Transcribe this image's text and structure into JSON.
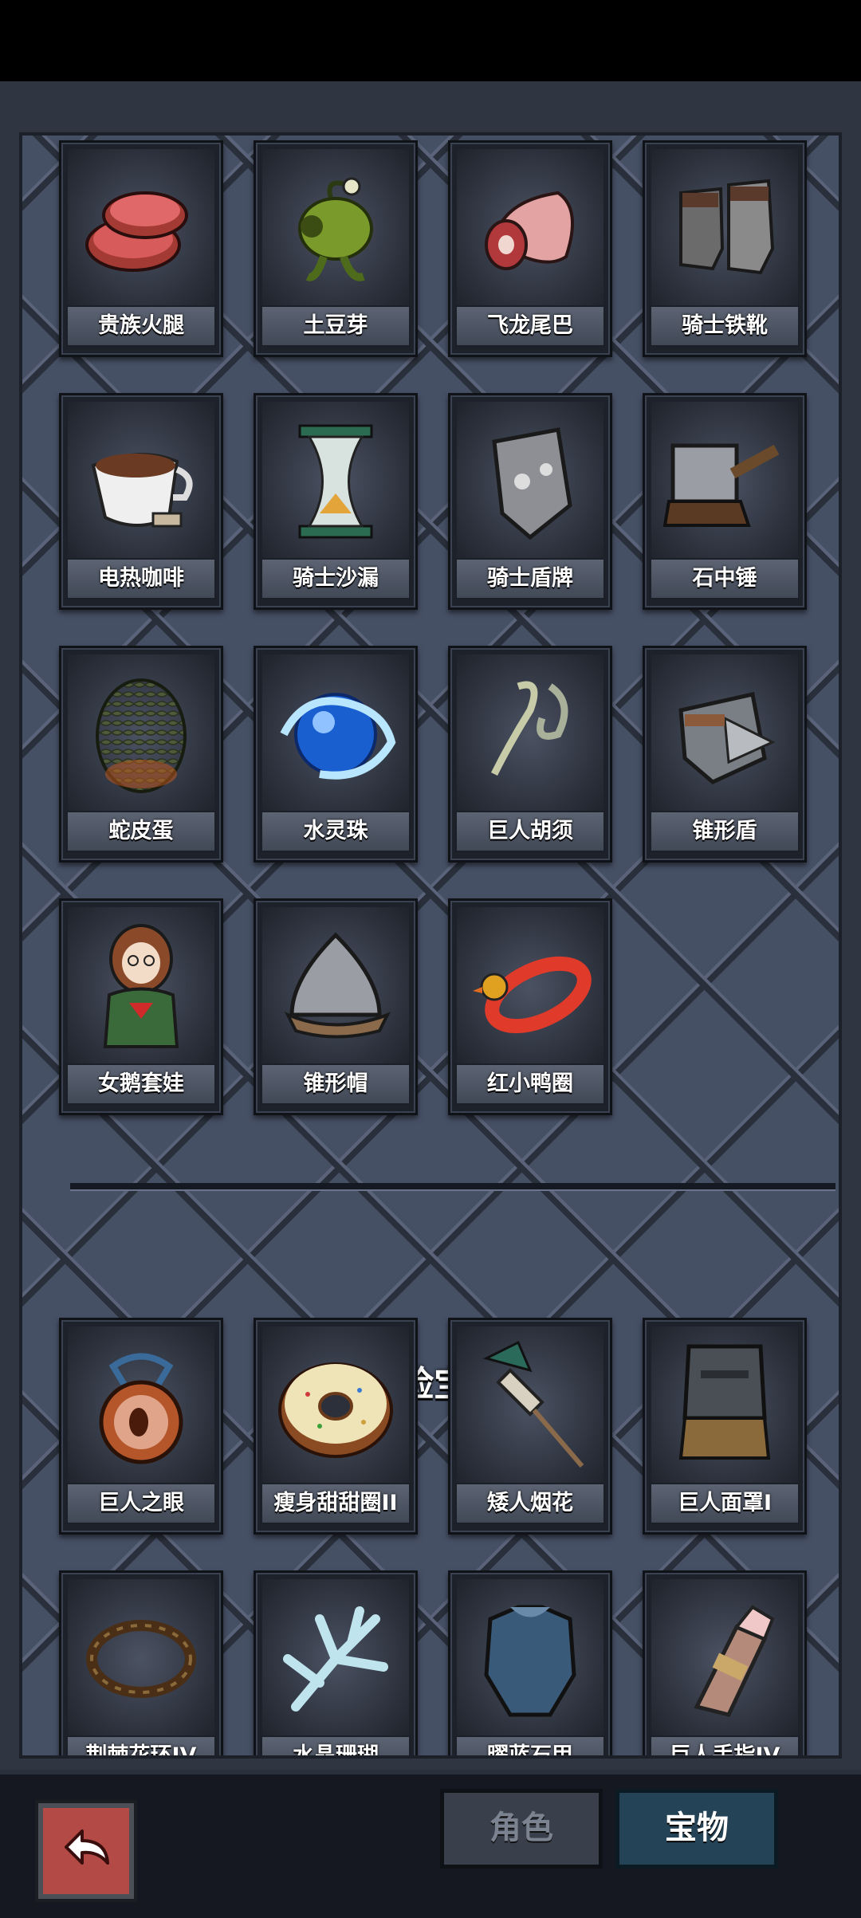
{
  "items": [
    {
      "label": "贵族火腿",
      "icon": "ham-icon"
    },
    {
      "label": "土豆芽",
      "icon": "potato-sprout-icon"
    },
    {
      "label": "飞龙尾巴",
      "icon": "dragon-tail-icon"
    },
    {
      "label": "骑士铁靴",
      "icon": "iron-boots-icon"
    },
    {
      "label": "电热咖啡",
      "icon": "coffee-cup-icon"
    },
    {
      "label": "骑士沙漏",
      "icon": "hourglass-icon"
    },
    {
      "label": "骑士盾牌",
      "icon": "knight-shield-icon"
    },
    {
      "label": "石中锤",
      "icon": "hammer-icon"
    },
    {
      "label": "蛇皮蛋",
      "icon": "snake-egg-icon"
    },
    {
      "label": "水灵珠",
      "icon": "water-orb-icon"
    },
    {
      "label": "巨人胡须",
      "icon": "giant-beard-icon"
    },
    {
      "label": "锥形盾",
      "icon": "cone-shield-icon"
    },
    {
      "label": "女鹅套娃",
      "icon": "matryoshka-icon"
    },
    {
      "label": "锥形帽",
      "icon": "cone-helmet-icon"
    },
    {
      "label": "红小鸭圈",
      "icon": "duck-ring-icon"
    }
  ],
  "adventure": {
    "title": "冒险宝物",
    "items": [
      {
        "label": "巨人之眼",
        "icon": "giant-eye-icon"
      },
      {
        "label": "瘦身甜甜圈II",
        "icon": "donut-icon"
      },
      {
        "label": "矮人烟花",
        "icon": "firework-icon"
      },
      {
        "label": "巨人面罩I",
        "icon": "giant-mask-icon"
      },
      {
        "label": "荆棘花环IV",
        "icon": "thorn-wreath-icon"
      },
      {
        "label": "水晶珊瑚",
        "icon": "crystal-coral-icon"
      },
      {
        "label": "曜蓝石甲",
        "icon": "blue-armor-icon"
      },
      {
        "label": "巨人手指IV",
        "icon": "giant-finger-icon"
      }
    ]
  },
  "nav": {
    "back_icon": "back-arrow-icon",
    "tabs": [
      {
        "label": "角色",
        "selected": false
      },
      {
        "label": "宝物",
        "selected": true
      }
    ]
  },
  "colors": {
    "accent_tab": "#244357",
    "back_button": "#b34a45"
  }
}
